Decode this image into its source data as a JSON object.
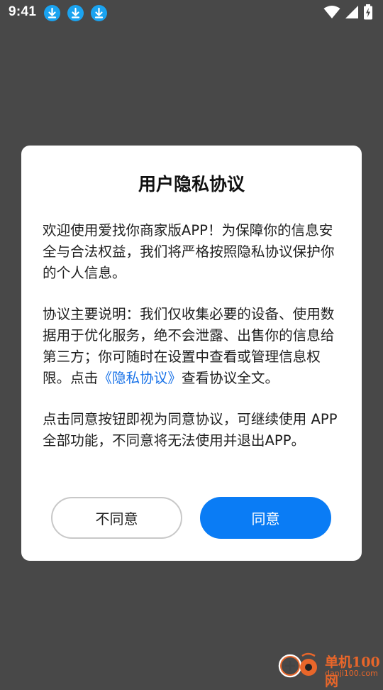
{
  "status_bar": {
    "time": "9:41",
    "notification_icons": [
      "download-icon",
      "download-icon",
      "download-icon"
    ],
    "icons": [
      "wifi-icon",
      "cellular-signal-icon",
      "battery-charging-icon"
    ]
  },
  "dialog": {
    "title": "用户隐私协议",
    "paragraph1": "欢迎使用爱找你商家版APP！为保障你的信息安全与合法权益，我们将严格按照隐私协议保护你的个人信息。",
    "paragraph2_before_link": "协议主要说明：我们仅收集必要的设备、使用数据用于优化服务，绝不会泄露、出售你的信息给第三方；你可随时在设置中查看或管理信息权限。点击",
    "paragraph2_link": "《隐私协议》",
    "paragraph2_after_link": "查看协议全文。",
    "paragraph3": "点击同意按钮即视为同意协议，可继续使用 APP 全部功能，不同意将无法使用并退出APP。",
    "disagree_label": "不同意",
    "agree_label": "同意"
  },
  "colors": {
    "overlay": "#484848",
    "primary": "#0a7cf5",
    "link": "#1a73e8",
    "download_badge": "#1aa3f0",
    "watermark": "#e8662a"
  },
  "watermark": {
    "title": "单机100网",
    "url": "danji100.com"
  }
}
